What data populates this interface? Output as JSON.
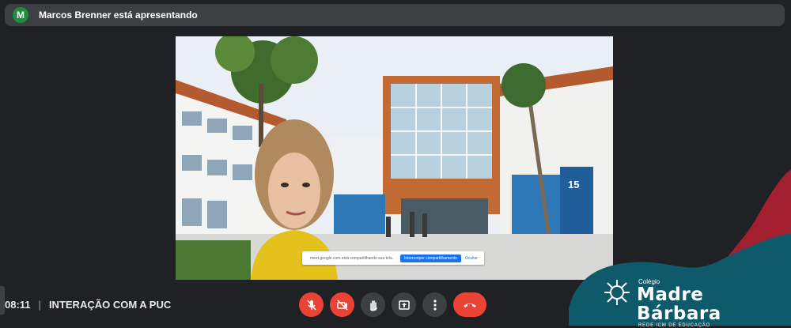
{
  "presenter": {
    "avatar_initial": "M",
    "text": "Marcos Brenner está apresentando"
  },
  "share_bar": {
    "message": "meet.google.com está compartilhando sua tela.",
    "stop_label": "Interromper compartilhamento",
    "hide_label": "Ocultar"
  },
  "meeting": {
    "time": "08:11",
    "title": "INTERAÇÃO COM A PUC"
  },
  "controls": [
    {
      "name": "microphone-off",
      "state": "off"
    },
    {
      "name": "camera-off",
      "state": "off"
    },
    {
      "name": "raise-hand"
    },
    {
      "name": "present-screen"
    },
    {
      "name": "more-options"
    },
    {
      "name": "leave-call"
    }
  ],
  "brand": {
    "small": "Colégio",
    "name": "Madre Bárbara",
    "tagline": "REDE ICM DE EDUCAÇÃO"
  },
  "colors": {
    "background": "#202124",
    "bar": "#3c4043",
    "danger": "#ea4335",
    "accent": "#1a73e8",
    "brand_teal": "#0e5a6b",
    "brand_red": "#a31f2f"
  }
}
